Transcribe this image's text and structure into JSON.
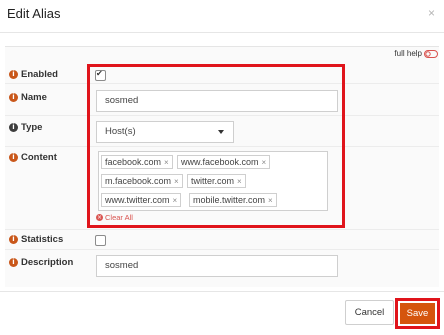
{
  "dialog": {
    "title": "Edit Alias",
    "close_glyph": "×",
    "full_help_label": "full help"
  },
  "fields": {
    "enabled": {
      "label": "Enabled",
      "checked": true
    },
    "name": {
      "label": "Name",
      "value": "sosmed"
    },
    "type": {
      "label": "Type",
      "selected": "Host(s)"
    },
    "content": {
      "label": "Content",
      "tags": [
        "facebook.com",
        "www.facebook.com",
        "m.facebook.com",
        "twitter.com",
        "www.twitter.com",
        "mobile.twitter.com"
      ],
      "tag_remove_glyph": "×",
      "clear_all_label": "Clear All"
    },
    "statistics": {
      "label": "Statistics",
      "checked": false
    },
    "description": {
      "label": "Description",
      "value": "sosmed"
    }
  },
  "footer": {
    "cancel_label": "Cancel",
    "save_label": "Save"
  },
  "colors": {
    "highlight": "#e0141b",
    "save_button": "#d5550d",
    "info_icon": "#c9571a",
    "toggle_icon": "#d9534f"
  },
  "icons": {
    "info": "info-circle-icon",
    "close": "close-icon",
    "toggle": "toggle-off-icon",
    "clear": "clear-all-icon",
    "caret": "caret-down-icon"
  }
}
